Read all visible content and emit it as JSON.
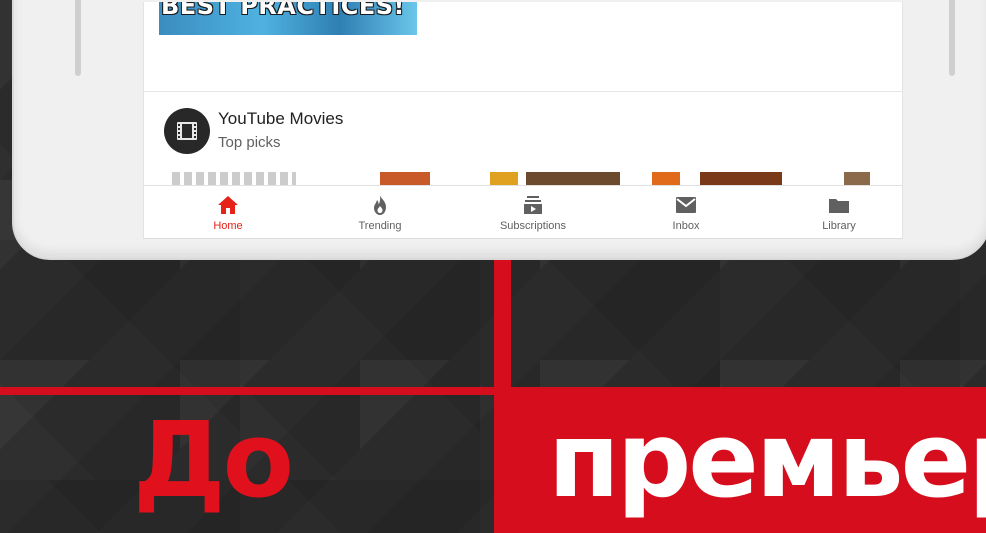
{
  "thumbnail": {
    "text": "BEST PRACTICES!"
  },
  "channel": {
    "title": "YouTube Movies",
    "subtitle": "Top picks"
  },
  "nav": {
    "items": [
      {
        "label": "Home",
        "icon": "home-icon",
        "active": true
      },
      {
        "label": "Trending",
        "icon": "flame-icon",
        "active": false
      },
      {
        "label": "Subscriptions",
        "icon": "subscriptions-icon",
        "active": false
      },
      {
        "label": "Inbox",
        "icon": "envelope-icon",
        "active": false
      },
      {
        "label": "Library",
        "icon": "folder-icon",
        "active": false
      }
    ]
  },
  "banner": {
    "left_text": "До",
    "right_text": "премьер"
  },
  "colors": {
    "accent_red": "#d50d1c",
    "youtube_red": "#e62117",
    "background_dark": "#2b2b2b"
  }
}
